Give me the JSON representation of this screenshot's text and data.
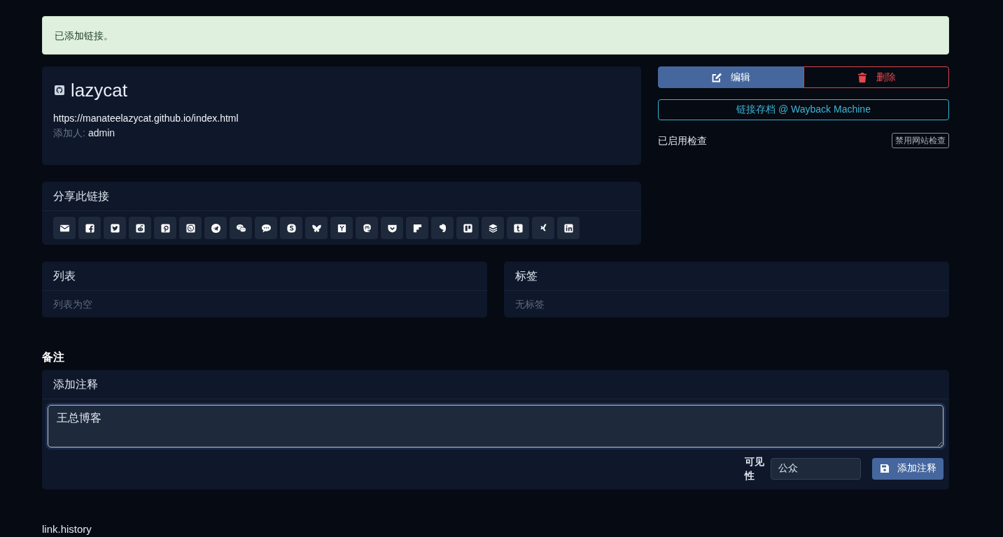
{
  "alert": {
    "text": "已添加链接。"
  },
  "link": {
    "title": "lazycat",
    "url": "https://manateelazycat.github.io/index.html",
    "added_by_label": "添加人:",
    "added_by": "admin"
  },
  "share": {
    "title": "分享此链接",
    "buttons": [
      {
        "kind": "email"
      },
      {
        "kind": "facebook"
      },
      {
        "kind": "twitter"
      },
      {
        "kind": "reddit"
      },
      {
        "kind": "pinterest"
      },
      {
        "kind": "whatsapp"
      },
      {
        "kind": "telegram"
      },
      {
        "kind": "wechat"
      },
      {
        "kind": "sms"
      },
      {
        "kind": "skype"
      },
      {
        "kind": "bluesky"
      },
      {
        "kind": "hackernews"
      },
      {
        "kind": "mastodon"
      },
      {
        "kind": "pocket"
      },
      {
        "kind": "flipboard"
      },
      {
        "kind": "evernote"
      },
      {
        "kind": "trello"
      },
      {
        "kind": "buffer"
      },
      {
        "kind": "tumblr"
      },
      {
        "kind": "xing"
      },
      {
        "kind": "linkedin"
      }
    ]
  },
  "actions": {
    "edit": "编辑",
    "delete": "删除",
    "archive": "链接存档 @ Wayback Machine"
  },
  "check": {
    "status": "已启用检查",
    "toggle_button": "禁用网站检查"
  },
  "lists": {
    "title": "列表",
    "empty": "列表为空"
  },
  "tags": {
    "title": "标签",
    "empty": "无标签"
  },
  "notes": {
    "heading": "备注",
    "card_title": "添加注释",
    "textarea": {
      "value": "王总博客",
      "focused": true
    },
    "visibility_label": "可见性",
    "visibility": "公众",
    "submit": "添加注释"
  },
  "history": {
    "heading": "link.history"
  }
}
